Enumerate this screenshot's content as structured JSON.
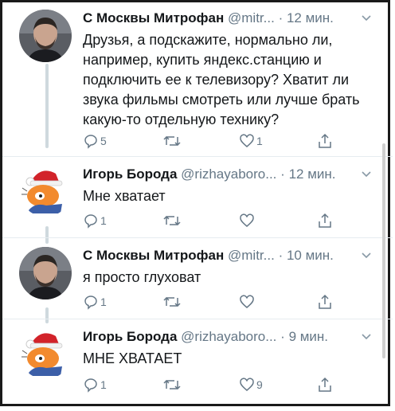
{
  "tweets": [
    {
      "name": "С Москвы Митрофан",
      "handle": "@mitr...",
      "sep": "·",
      "time": "12 мин.",
      "text": "Друзья, а подскажите, нормально ли, например, купить яндекс.станцию и подключить ее к телевизору? Хватит ли звука фильмы смотреть или лучше брать какую-то отдельную технику?",
      "reply_count": "5",
      "retweet_count": "",
      "like_count": "1",
      "avatar": "man-photo-avatar"
    },
    {
      "name": "Игорь Борода",
      "handle": "@rizhayaboro...",
      "sep": "·",
      "time": "12 мин.",
      "text": "Мне хватает",
      "reply_count": "1",
      "retweet_count": "",
      "like_count": "",
      "avatar": "cartoon-cat-santa-hat-avatar"
    },
    {
      "name": "С Москвы Митрофан",
      "handle": "@mitr...",
      "sep": "·",
      "time": "10 мин.",
      "text": "я просто глуховат",
      "reply_count": "1",
      "retweet_count": "",
      "like_count": "",
      "avatar": "man-photo-avatar"
    },
    {
      "name": "Игорь Борода",
      "handle": "@rizhayaboro...",
      "sep": "·",
      "time": "9 мин.",
      "text": "МНЕ ХВАТАЕТ",
      "reply_count": "1",
      "retweet_count": "",
      "like_count": "9",
      "avatar": "cartoon-cat-santa-hat-avatar"
    }
  ],
  "colors": {
    "text": "#14171a",
    "secondary": "#657786",
    "thread_line": "#cfd9de"
  }
}
